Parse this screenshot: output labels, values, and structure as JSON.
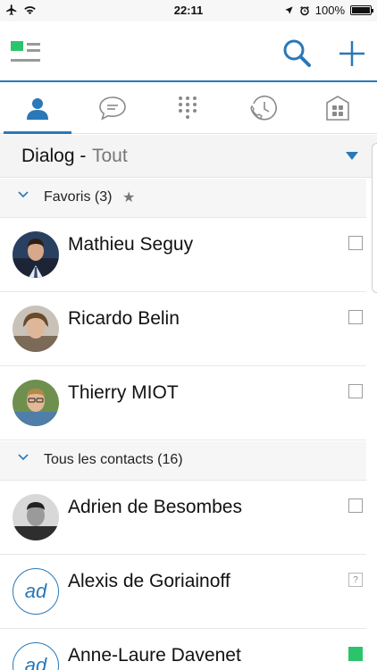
{
  "status_bar": {
    "time": "22:11",
    "battery": "100%",
    "battery_level": 1.0,
    "icons": [
      "airplane-icon",
      "wifi-icon",
      "location-icon",
      "alarm-icon",
      "battery-icon"
    ]
  },
  "header": {
    "icons": [
      "menu-logo-icon",
      "search-icon",
      "plus-icon"
    ]
  },
  "tabs": [
    {
      "name": "contacts",
      "icon": "person-icon",
      "active": true
    },
    {
      "name": "messages",
      "icon": "chat-bubble-icon",
      "active": false
    },
    {
      "name": "dialpad",
      "icon": "dialpad-icon",
      "active": false
    },
    {
      "name": "history",
      "icon": "call-history-icon",
      "active": false
    },
    {
      "name": "apps",
      "icon": "apps-icon",
      "active": false
    }
  ],
  "filter": {
    "title": "Dialog -",
    "value": "Tout"
  },
  "sections": {
    "favorites": {
      "label": "Favoris (3)",
      "star": "★"
    },
    "all_contacts": {
      "label": "Tous les contacts (16)"
    }
  },
  "contacts": [
    {
      "name": "Mathieu Seguy",
      "avatar": "photo",
      "status": "offline"
    },
    {
      "name": "Ricardo Belin",
      "avatar": "photo",
      "status": "offline"
    },
    {
      "name": "Thierry MIOT",
      "avatar": "photo",
      "status": "offline"
    },
    {
      "name": "Adrien de Besombes",
      "avatar": "photo",
      "status": "offline"
    },
    {
      "name": "Alexis de Goriainoff",
      "avatar": "initials",
      "initials": "ad",
      "status": "unknown",
      "status_glyph": "?"
    },
    {
      "name": "Anne-Laure Davenet",
      "avatar": "initials",
      "initials": "ad",
      "status": "online"
    }
  ],
  "colors": {
    "accent": "#2a78b8",
    "online": "#2cc46b",
    "logo_green": "#2cc46b"
  }
}
